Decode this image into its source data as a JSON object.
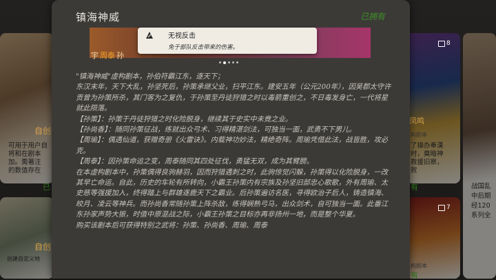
{
  "left_cards": {
    "card1_title": "自创",
    "card1_desc": "可用于用户自\n将和在剧本\n加。需著注\n的数值存在",
    "card2_corner": "已",
    "card2_title": "自创",
    "card2_desc": "创建自定义地"
  },
  "right_cards": {
    "card1_badge": "8",
    "card1_label": "凤鸣",
    "card1_sub": "构剧本",
    "card1_desc": "了操办奉漢\n时，奠暗神\n救援旧察，\n败",
    "card1_owned": "有",
    "card2_badge": "7",
    "card2_sub": "构剧本",
    "card2_owned": "有",
    "card3_desc": "战国乱\n中后期\n经120\n系列全"
  },
  "modal": {
    "title": "镇海神威",
    "owned_label": "已拥有",
    "banner_names": [
      "宇",
      "周泰",
      "孙"
    ],
    "tooltip": {
      "icon": "skill-emblem-icon",
      "title": "无视反击",
      "desc": "免于部队反击带来的伤害。"
    },
    "pager_count": 5,
    "pager_active": 1,
    "paragraphs": [
      "\"镇海神威\"虚构剧本，孙伯符霸江东，逐天下；",
      "东汉末年，天下大乱，孙坚死后，孙策承继父业，扫平江东。建安五年（公元200年），因吴郡太守许贡曾为孙策所杀，其门客为之复仇，于孙策至丹徒狩猎之时以毒箭重创之，不日毒发身亡，一代将星就此陨落。",
      "【孙策】：孙策于丹徒狩猎之时化险脱身，继续其于史实中未竟之业。",
      "【孙尚香】：随同孙策征战，练就出众弓术、习得精湛剑法，可独当一面，武勇不下男儿。",
      "【周瑜】：偶遇仙道，获赠奇册《火雷诀》。内载神功妙法，精绝奇阵。周瑜凭借此法，战皆胜，攻必克。",
      "【周泰】：因孙策命运之变，周泰随同其四处征伐，勇猛无双，成为其臂膀。",
      "在本虚构剧本中，孙策偶得良驹赫羽，因而狩猎遇刺之时，此驹惊觉闪躲，孙策得以化险脱身，一改其早亡命运。自此，历史的车轮有所转向，小霸王孙策内有宗族及孙坚旧部忠心歌歌，外有周瑜、太史慈等强援加入，终得踏上与群雄逐鹿天下之霸业。后孙策遍访名医，寻得欧治子后人，铸造镇海、皎月、凌云等神兵。而孙尚香常随孙策上阵杀敌，练得娴熟弓马，出众剑术，自可独当一面。此番江东孙家声势大振，时值中原混战之际，小霸王孙策之目标亦再非扬州一地，而是整个华夏。",
      "购买该剧本后可获得特别之武将：孙策、孙尚香、周瑜、周泰"
    ]
  }
}
